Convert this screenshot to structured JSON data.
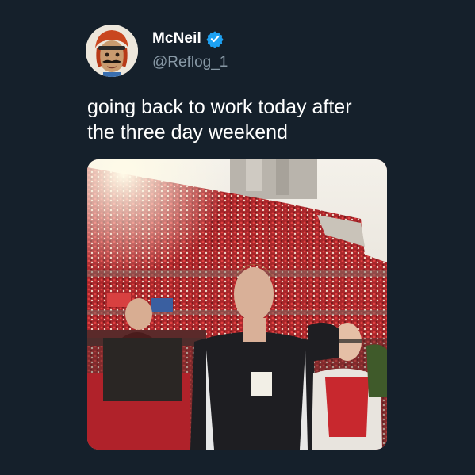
{
  "tweet": {
    "author": {
      "display_name": "McNeil",
      "handle": "@Reflog_1",
      "verified": true,
      "avatar_icon": "avatar-costume-mustache"
    },
    "text": "going back to work today after\nthe three day weekend",
    "media": {
      "type": "photo",
      "alt_icon": "stadium-crowd-photo"
    }
  },
  "theme": {
    "background": "#15202b",
    "text_primary": "#ffffff",
    "text_secondary": "#8899a6",
    "verified_color": "#1da1f2"
  }
}
